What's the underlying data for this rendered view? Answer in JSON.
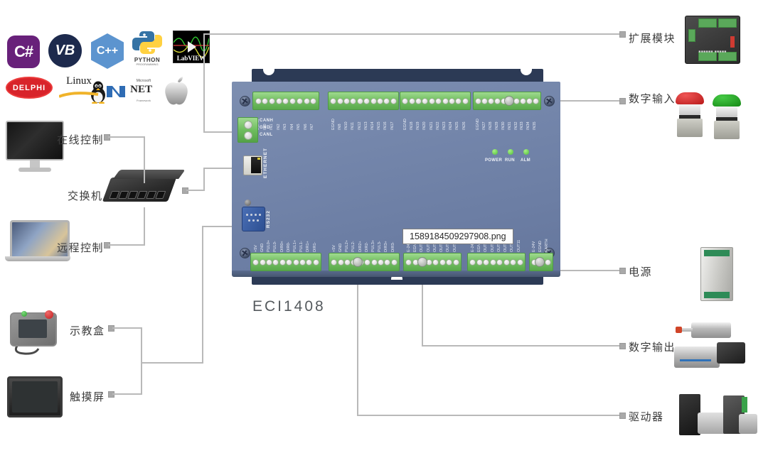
{
  "tooltip": {
    "filename": "1589184509297908.png"
  },
  "board": {
    "model": "ECI1408",
    "leds": [
      {
        "name": "POWER",
        "color": "#4fbf39"
      },
      {
        "name": "RUN",
        "color": "#4fbf39"
      },
      {
        "name": "ALM",
        "color": "#4fbf39"
      }
    ],
    "ports": {
      "ethernet": "ETHERNET",
      "rs232": "RS232",
      "can": [
        "CANH",
        "GND",
        "CANL"
      ]
    },
    "top_terminals": [
      {
        "id": "in0-in7",
        "pins": [
          "EGND",
          "IN0",
          "IN1",
          "IN2",
          "IN3",
          "IN4",
          "IN5",
          "IN6",
          "IN7"
        ]
      },
      {
        "id": "in8-in17",
        "pins": [
          "EGND",
          "IN8",
          "IN10",
          "IN11",
          "IN12",
          "IN13",
          "IN14",
          "IN15",
          "IN16",
          "IN17"
        ]
      },
      {
        "id": "in18-in26",
        "pins": [
          "EGND",
          "IN18",
          "IN19",
          "IN20",
          "IN21",
          "IN22",
          "IN23",
          "IN24",
          "IN25",
          "IN26"
        ]
      },
      {
        "id": "in27-in35",
        "pins": [
          "EGND",
          "IN27",
          "IN28",
          "IN29",
          "IN30",
          "IN31",
          "IN32",
          "IN33",
          "IN34",
          "IN35"
        ]
      }
    ],
    "bottom_terminals": [
      {
        "id": "axis0-1",
        "pins": [
          "+5V",
          "GND",
          "PUL0+",
          "PUL0-",
          "DIR0+",
          "DIR0-",
          "PUL1+",
          "PUL1-",
          "DIR1+",
          "DIR1-"
        ]
      },
      {
        "id": "axis2-3",
        "pins": [
          "+5V",
          "GND",
          "PUL2+",
          "PUL2-",
          "DIR2+",
          "DIR2-",
          "PUL3+",
          "PUL3-",
          "DIR3+",
          "DIR3-"
        ]
      },
      {
        "id": "out0-out5",
        "pins": [
          "E-24V",
          "EGND",
          "OUT0",
          "OUT1",
          "OUT2",
          "OUT3",
          "OUT4",
          "OUT5"
        ]
      },
      {
        "id": "out6-out11",
        "pins": [
          "E-24V",
          "EGND",
          "OUT6",
          "OUT7",
          "OUT8",
          "OUT9",
          "OUT10",
          "OUT11"
        ]
      },
      {
        "id": "power-earth",
        "pins": [
          "E-24V",
          "EGND",
          "EARTH"
        ]
      }
    ]
  },
  "left_labels": [
    {
      "id": "online-control",
      "text": "在线控制"
    },
    {
      "id": "switch",
      "text": "交换机"
    },
    {
      "id": "remote-control",
      "text": "远程控制"
    },
    {
      "id": "teach-pendant",
      "text": "示教盒"
    },
    {
      "id": "touch-screen",
      "text": "触摸屏"
    }
  ],
  "right_labels": [
    {
      "id": "expansion-module",
      "text": "扩展模块"
    },
    {
      "id": "digital-input",
      "text": "数字输入"
    },
    {
      "id": "power-supply",
      "text": "电源"
    },
    {
      "id": "digital-output",
      "text": "数字输出"
    },
    {
      "id": "driver",
      "text": "驱动器"
    }
  ],
  "logos": [
    {
      "id": "csharp",
      "text": "C#"
    },
    {
      "id": "vb",
      "text": "VB"
    },
    {
      "id": "cpp",
      "text": "C++"
    },
    {
      "id": "python",
      "text": "PYTHON",
      "sub": "PROGRAMMING"
    },
    {
      "id": "labview",
      "text": "LabVIEW"
    },
    {
      "id": "delphi",
      "text": "DELPHI"
    },
    {
      "id": "linux",
      "text": "Linux"
    },
    {
      "id": "dotnet",
      "text": "NET",
      "micro": "Microsoft",
      "fw": "Framework"
    },
    {
      "id": "apple",
      "text": ""
    }
  ],
  "colors": {
    "board_face": "#7486ab",
    "board_flange": "#2c3a55",
    "terminal_green": "#74c163",
    "led_green": "#4fbf39",
    "line_gray": "#b9b9b9",
    "background": "#ffffff"
  }
}
